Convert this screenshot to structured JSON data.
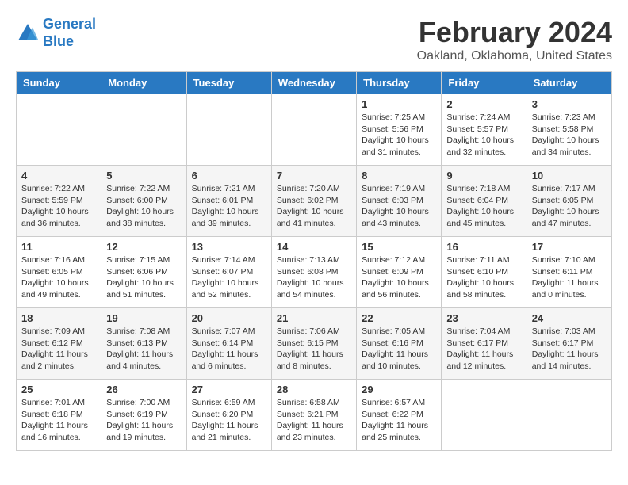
{
  "logo": {
    "line1": "General",
    "line2": "Blue"
  },
  "title": "February 2024",
  "subtitle": "Oakland, Oklahoma, United States",
  "days_of_week": [
    "Sunday",
    "Monday",
    "Tuesday",
    "Wednesday",
    "Thursday",
    "Friday",
    "Saturday"
  ],
  "weeks": [
    [
      {
        "num": "",
        "info": ""
      },
      {
        "num": "",
        "info": ""
      },
      {
        "num": "",
        "info": ""
      },
      {
        "num": "",
        "info": ""
      },
      {
        "num": "1",
        "info": "Sunrise: 7:25 AM\nSunset: 5:56 PM\nDaylight: 10 hours\nand 31 minutes."
      },
      {
        "num": "2",
        "info": "Sunrise: 7:24 AM\nSunset: 5:57 PM\nDaylight: 10 hours\nand 32 minutes."
      },
      {
        "num": "3",
        "info": "Sunrise: 7:23 AM\nSunset: 5:58 PM\nDaylight: 10 hours\nand 34 minutes."
      }
    ],
    [
      {
        "num": "4",
        "info": "Sunrise: 7:22 AM\nSunset: 5:59 PM\nDaylight: 10 hours\nand 36 minutes."
      },
      {
        "num": "5",
        "info": "Sunrise: 7:22 AM\nSunset: 6:00 PM\nDaylight: 10 hours\nand 38 minutes."
      },
      {
        "num": "6",
        "info": "Sunrise: 7:21 AM\nSunset: 6:01 PM\nDaylight: 10 hours\nand 39 minutes."
      },
      {
        "num": "7",
        "info": "Sunrise: 7:20 AM\nSunset: 6:02 PM\nDaylight: 10 hours\nand 41 minutes."
      },
      {
        "num": "8",
        "info": "Sunrise: 7:19 AM\nSunset: 6:03 PM\nDaylight: 10 hours\nand 43 minutes."
      },
      {
        "num": "9",
        "info": "Sunrise: 7:18 AM\nSunset: 6:04 PM\nDaylight: 10 hours\nand 45 minutes."
      },
      {
        "num": "10",
        "info": "Sunrise: 7:17 AM\nSunset: 6:05 PM\nDaylight: 10 hours\nand 47 minutes."
      }
    ],
    [
      {
        "num": "11",
        "info": "Sunrise: 7:16 AM\nSunset: 6:05 PM\nDaylight: 10 hours\nand 49 minutes."
      },
      {
        "num": "12",
        "info": "Sunrise: 7:15 AM\nSunset: 6:06 PM\nDaylight: 10 hours\nand 51 minutes."
      },
      {
        "num": "13",
        "info": "Sunrise: 7:14 AM\nSunset: 6:07 PM\nDaylight: 10 hours\nand 52 minutes."
      },
      {
        "num": "14",
        "info": "Sunrise: 7:13 AM\nSunset: 6:08 PM\nDaylight: 10 hours\nand 54 minutes."
      },
      {
        "num": "15",
        "info": "Sunrise: 7:12 AM\nSunset: 6:09 PM\nDaylight: 10 hours\nand 56 minutes."
      },
      {
        "num": "16",
        "info": "Sunrise: 7:11 AM\nSunset: 6:10 PM\nDaylight: 10 hours\nand 58 minutes."
      },
      {
        "num": "17",
        "info": "Sunrise: 7:10 AM\nSunset: 6:11 PM\nDaylight: 11 hours\nand 0 minutes."
      }
    ],
    [
      {
        "num": "18",
        "info": "Sunrise: 7:09 AM\nSunset: 6:12 PM\nDaylight: 11 hours\nand 2 minutes."
      },
      {
        "num": "19",
        "info": "Sunrise: 7:08 AM\nSunset: 6:13 PM\nDaylight: 11 hours\nand 4 minutes."
      },
      {
        "num": "20",
        "info": "Sunrise: 7:07 AM\nSunset: 6:14 PM\nDaylight: 11 hours\nand 6 minutes."
      },
      {
        "num": "21",
        "info": "Sunrise: 7:06 AM\nSunset: 6:15 PM\nDaylight: 11 hours\nand 8 minutes."
      },
      {
        "num": "22",
        "info": "Sunrise: 7:05 AM\nSunset: 6:16 PM\nDaylight: 11 hours\nand 10 minutes."
      },
      {
        "num": "23",
        "info": "Sunrise: 7:04 AM\nSunset: 6:17 PM\nDaylight: 11 hours\nand 12 minutes."
      },
      {
        "num": "24",
        "info": "Sunrise: 7:03 AM\nSunset: 6:17 PM\nDaylight: 11 hours\nand 14 minutes."
      }
    ],
    [
      {
        "num": "25",
        "info": "Sunrise: 7:01 AM\nSunset: 6:18 PM\nDaylight: 11 hours\nand 16 minutes."
      },
      {
        "num": "26",
        "info": "Sunrise: 7:00 AM\nSunset: 6:19 PM\nDaylight: 11 hours\nand 19 minutes."
      },
      {
        "num": "27",
        "info": "Sunrise: 6:59 AM\nSunset: 6:20 PM\nDaylight: 11 hours\nand 21 minutes."
      },
      {
        "num": "28",
        "info": "Sunrise: 6:58 AM\nSunset: 6:21 PM\nDaylight: 11 hours\nand 23 minutes."
      },
      {
        "num": "29",
        "info": "Sunrise: 6:57 AM\nSunset: 6:22 PM\nDaylight: 11 hours\nand 25 minutes."
      },
      {
        "num": "",
        "info": ""
      },
      {
        "num": "",
        "info": ""
      }
    ]
  ]
}
